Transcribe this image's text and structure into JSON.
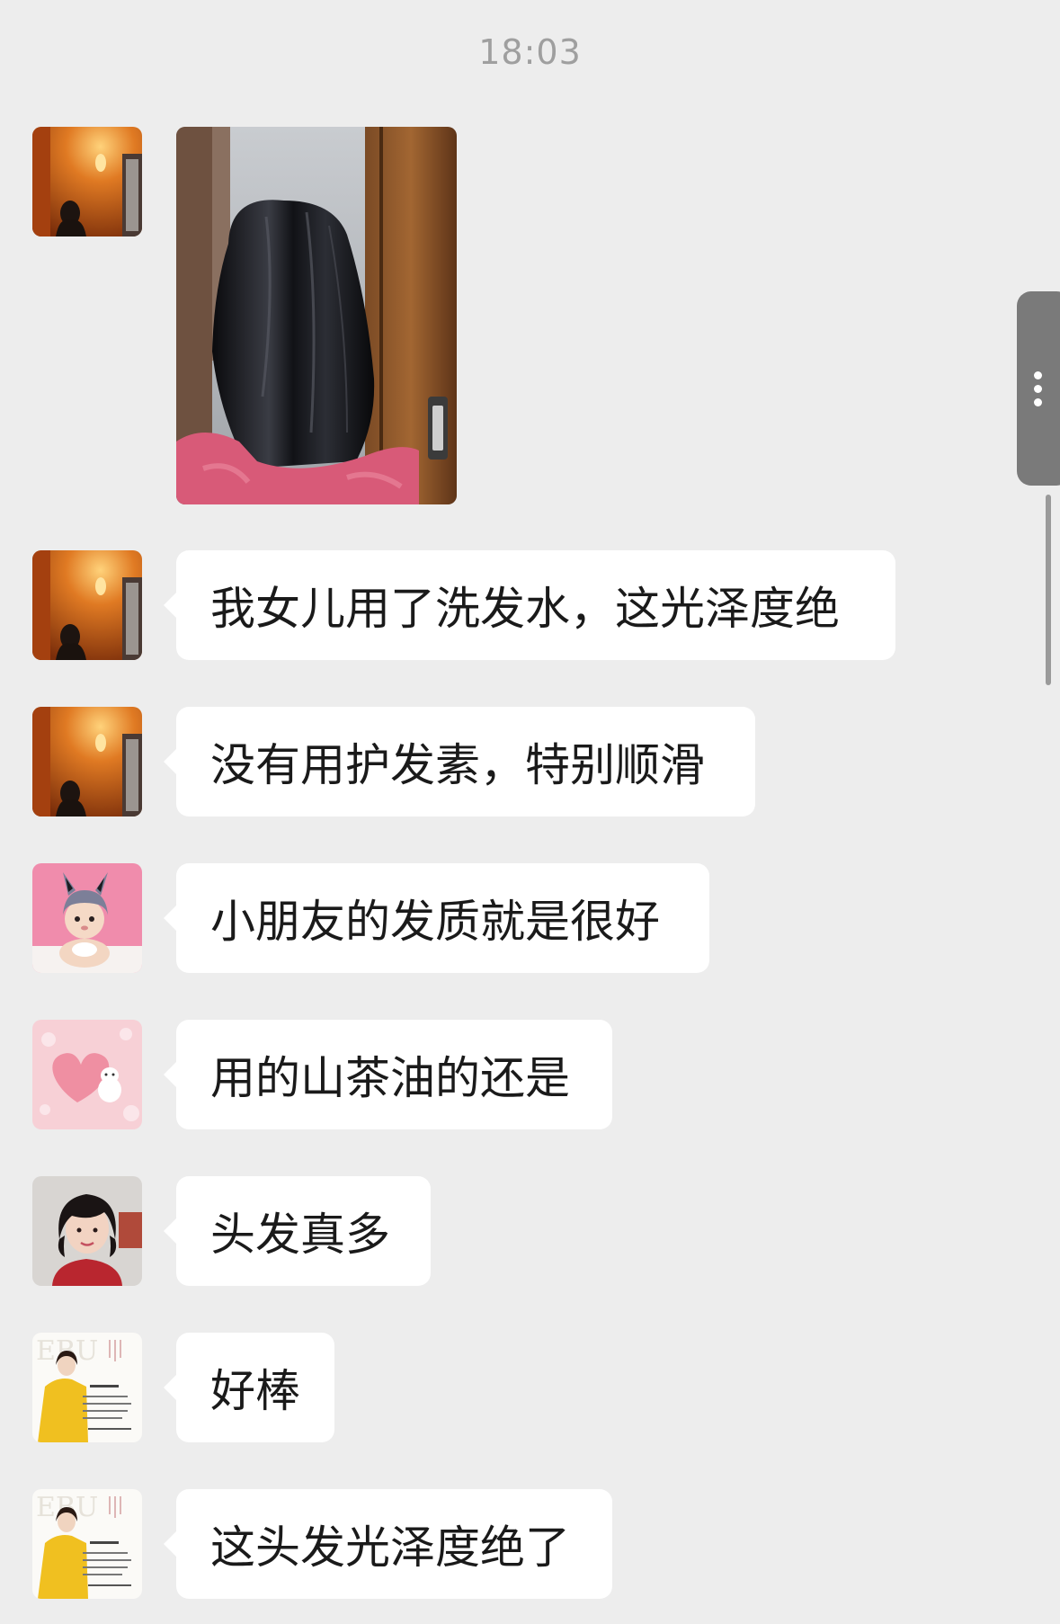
{
  "chat": {
    "timestamp": "18:03",
    "messages": [
      {
        "type": "image",
        "avatar": "orange-hallway-woman-avatar",
        "image": "black-hair-back-view-photo"
      },
      {
        "type": "text",
        "avatar": "orange-hallway-woman-avatar",
        "text": "我女儿用了洗发水，这光泽度绝"
      },
      {
        "type": "text",
        "avatar": "orange-hallway-woman-avatar",
        "text": "没有用护发素，特别顺滑"
      },
      {
        "type": "text",
        "avatar": "baby-bunny-hat-avatar",
        "text": "小朋友的发质就是很好"
      },
      {
        "type": "text",
        "avatar": "pink-heart-plush-avatar",
        "text": "用的山茶油的还是"
      },
      {
        "type": "text",
        "avatar": "short-hair-woman-avatar",
        "text": "头发真多"
      },
      {
        "type": "text",
        "avatar": "yellow-suit-poster-avatar",
        "text": "好棒"
      },
      {
        "type": "text",
        "avatar": "yellow-suit-poster-avatar",
        "text": "这头发光泽度绝了"
      }
    ]
  },
  "colors": {
    "background": "#ededed",
    "bubble": "#ffffff",
    "text": "#1a1a1a",
    "timestamp": "#9f9f9f"
  },
  "side_handle": {
    "icon": "more-dots-icon"
  }
}
